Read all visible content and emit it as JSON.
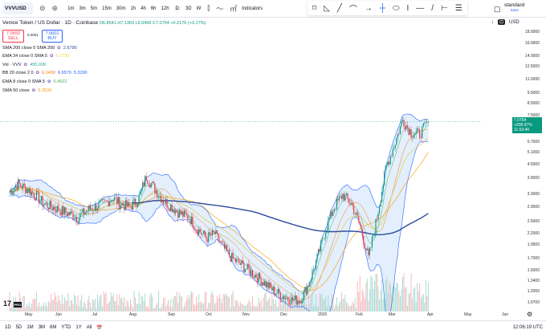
{
  "toolbar": {
    "symbol": "VVVUSD",
    "intervals": [
      "1m",
      "3m",
      "5m",
      "15m",
      "30m",
      "1h",
      "4h",
      "6h",
      "12h",
      "D",
      "3D",
      "W"
    ],
    "indicators_label": "Indicators",
    "layout_name": "standard",
    "layout_sub": "Save"
  },
  "legend": {
    "title": "Venice Token / US Dollar · 1D · Coinbase",
    "ohlc": "O6.8541 H7.1363 L6.5469 C7.0754 +0.2176 (+3.17%)",
    "sell_price": "7.0550",
    "sell_label": "SELL",
    "spread": "0.0051",
    "buy_price": "7.0601",
    "buy_label": "BUY",
    "indicators": [
      {
        "name": "SMA 200 close 0 SMA 200",
        "values": [
          "2.6790"
        ],
        "colors": [
          "#2a4a9c"
        ]
      },
      {
        "name": "EMA 34 close 0 SMA 5",
        "values": [
          "5.7739"
        ],
        "colors": [
          "#f5d142"
        ]
      },
      {
        "name": "Vol · VVV",
        "values": [
          "455.02K"
        ],
        "colors": [
          "#26a69a"
        ]
      },
      {
        "name": "BB 20 close 2 0",
        "values": [
          "6.1430",
          "6.9570",
          "5.3290"
        ],
        "colors": [
          "#f57c00",
          "#2962ff",
          "#2962ff"
        ]
      },
      {
        "name": "EMA 8 close 0 SMA 5",
        "values": [
          "6.4922"
        ],
        "colors": [
          "#4caf50"
        ]
      },
      {
        "name": "SMA 50 close",
        "values": [
          "5.3534"
        ],
        "colors": [
          "#ff9800"
        ]
      }
    ]
  },
  "price_axis": {
    "currency": "USD",
    "labels": [
      "18.0000",
      "16.0000",
      "14.0000",
      "12.5000",
      "11.0000",
      "9.5000",
      "8.5000",
      "7.5000",
      "5.7000",
      "5.1000",
      "4.5000",
      "3.9000",
      "3.3000",
      "2.9000",
      "2.5000",
      "2.2000",
      "1.9500",
      "1.7000",
      "1.5000",
      "1.3400",
      "1.2000",
      "1.0700"
    ],
    "scale": "log"
  },
  "last_price_tag": {
    "price": "7.0754",
    "change": "+208.97%",
    "countdown": "11:53:40",
    "color": "#089981"
  },
  "time_axis": [
    "May",
    "Jun",
    "Jul",
    "Aug",
    "Sep",
    "Oct",
    "Nov",
    "Dec",
    "2026",
    "Feb",
    "Mar",
    "Apr",
    "May",
    "Jun"
  ],
  "bottom": {
    "ranges": [
      "1D",
      "5D",
      "1M",
      "3M",
      "6M",
      "YTD",
      "1Y",
      "All"
    ],
    "clock": "12:06:19 UTC"
  },
  "logo_text": "TV PRO",
  "chart_data": {
    "type": "candlestick",
    "weekly_close_approx": [
      3.4,
      3.7,
      3.5,
      3.3,
      3.0,
      2.9,
      2.8,
      2.7,
      2.6,
      2.8,
      2.9,
      3.0,
      3.2,
      3.0,
      2.9,
      3.1,
      4.0,
      3.5,
      3.1,
      2.9,
      2.7,
      2.6,
      2.3,
      2.1,
      2.2,
      1.9,
      1.7,
      1.6,
      1.5,
      1.4,
      1.3,
      1.2,
      1.15,
      1.1,
      1.1,
      1.3,
      1.7,
      2.3,
      2.9,
      3.3,
      3.0,
      2.4,
      1.7,
      2.6,
      4.3,
      5.5,
      7.2,
      6.3,
      6.2,
      7.0754
    ],
    "colors": {
      "up": "#089981",
      "down": "#f23645",
      "sma200": "#2a4a9c",
      "bb": "#2962ff",
      "bb_fill": "#e3effd"
    }
  }
}
